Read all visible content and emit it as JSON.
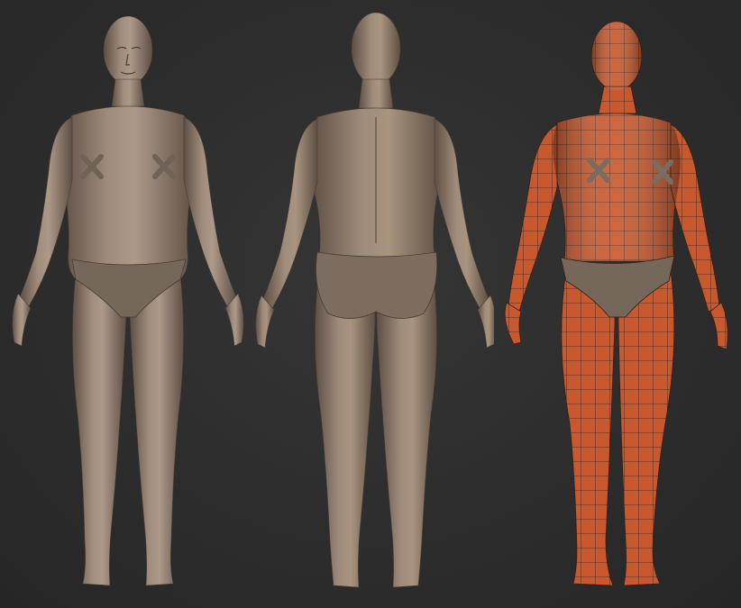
{
  "scene": {
    "background_color": "#2e2e2e",
    "skin_color": "#8f7b6c",
    "skin_highlight": "#b29e8e",
    "skin_shadow": "#5e4f44",
    "wireframe_color": "#c8592f",
    "wireframe_line_color": "#3a1e12",
    "garment_color": "#76675b"
  },
  "views": [
    {
      "id": "front",
      "icon": "sculpt-front-icon"
    },
    {
      "id": "back",
      "icon": "sculpt-back-icon"
    },
    {
      "id": "wireframe",
      "icon": "polygroup-wireframe-icon"
    }
  ]
}
